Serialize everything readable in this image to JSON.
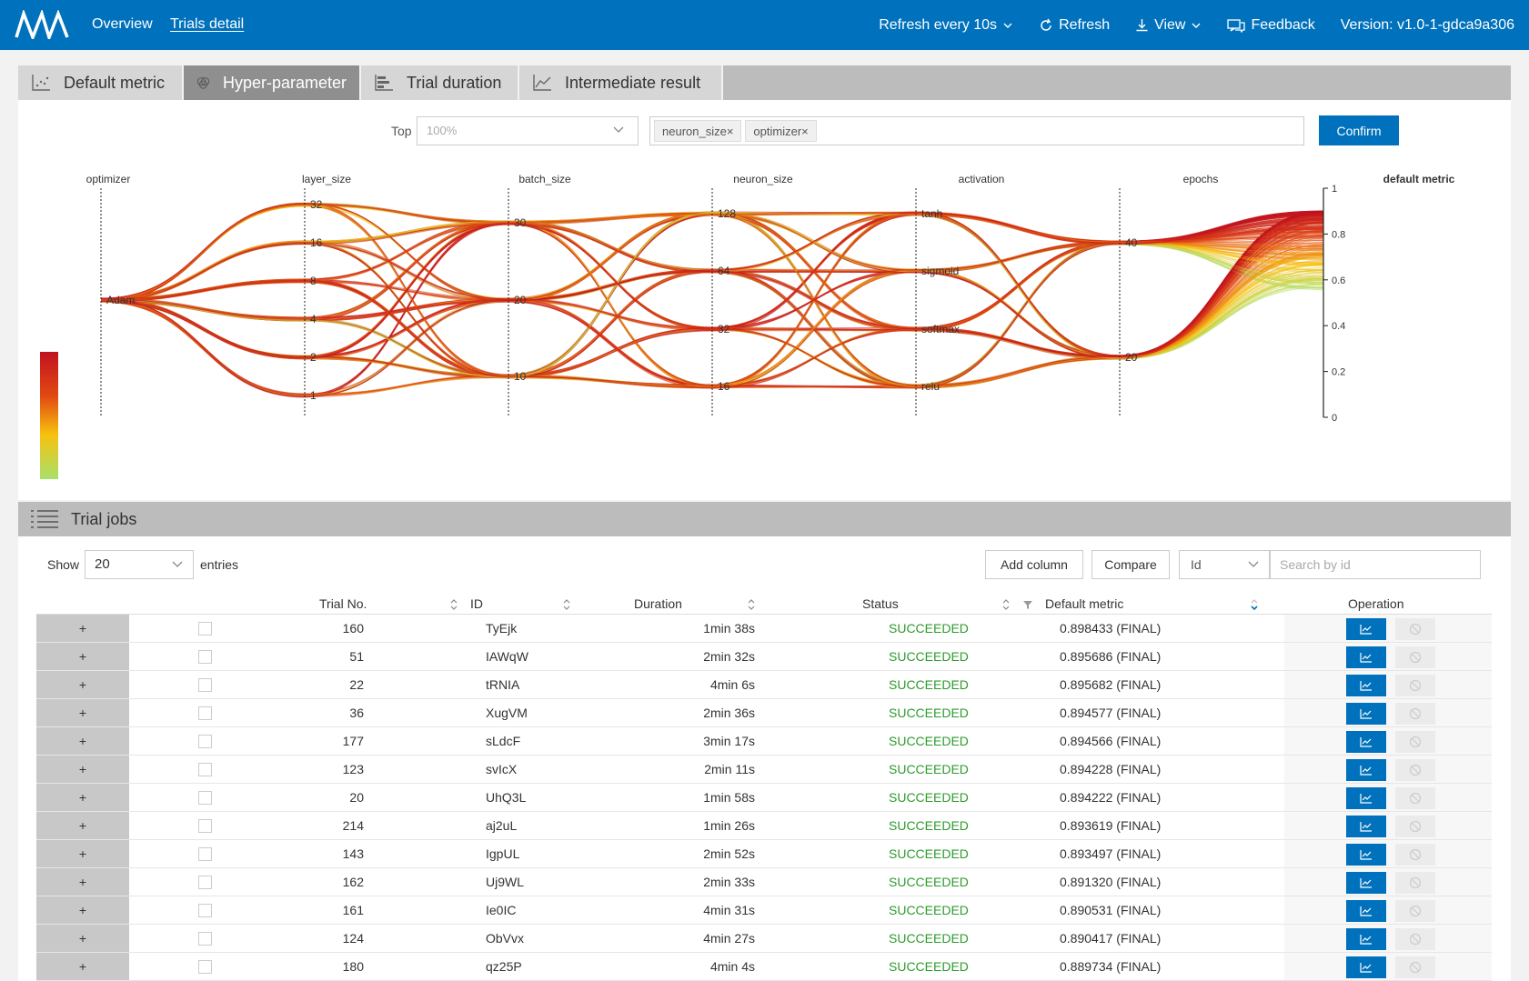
{
  "nav": {
    "overview": "Overview",
    "trials_detail": "Trials detail",
    "refresh_interval": "Refresh every 10s",
    "refresh": "Refresh",
    "view": "View",
    "feedback": "Feedback",
    "version": "Version: v1.0-1-gdca9a306"
  },
  "tabs": [
    "Default metric",
    "Hyper-parameter",
    "Trial duration",
    "Intermediate result"
  ],
  "hyper": {
    "top_label": "Top",
    "top_value": "100%",
    "tags": [
      "neuron_size×",
      "optimizer×"
    ],
    "confirm": "Confirm"
  },
  "chart_data": {
    "type": "parallel-coordinates",
    "axes": [
      {
        "name": "optimizer",
        "ticks": [
          "Adam"
        ]
      },
      {
        "name": "layer_size",
        "ticks": [
          "32",
          "16",
          "8",
          "4",
          "2",
          "1"
        ]
      },
      {
        "name": "batch_size",
        "ticks": [
          "30",
          "20",
          "10"
        ]
      },
      {
        "name": "neuron_size",
        "ticks": [
          "128",
          "64",
          "32",
          "16"
        ]
      },
      {
        "name": "activation",
        "ticks": [
          "tanh",
          "sigmoid",
          "softmax",
          "relu"
        ]
      },
      {
        "name": "epochs",
        "ticks": [
          "40",
          "20"
        ]
      },
      {
        "name": "default metric",
        "ticks": [
          "1",
          "0.8",
          "0.6",
          "0.4",
          "0.2",
          "0"
        ],
        "range": [
          0,
          1
        ]
      }
    ],
    "color_scale": [
      "#c1121f",
      "#e24a12",
      "#f7c10f",
      "#a8e06a"
    ]
  },
  "jobs": {
    "title": "Trial jobs",
    "show": "Show",
    "page_size": "20",
    "entries": "entries",
    "add_column": "Add column",
    "compare": "Compare",
    "search_by": "Id",
    "search_placeholder": "Search by id",
    "columns": [
      "Trial No.",
      "ID",
      "Duration",
      "Status",
      "Default metric",
      "Operation"
    ],
    "expand_symbol": "+",
    "rows": [
      {
        "no": "160",
        "id": "TyEjk",
        "duration": "1min 38s",
        "status": "SUCCEEDED",
        "metric": "0.898433 (FINAL)"
      },
      {
        "no": "51",
        "id": "IAWqW",
        "duration": "2min 32s",
        "status": "SUCCEEDED",
        "metric": "0.895686 (FINAL)"
      },
      {
        "no": "22",
        "id": "tRNIA",
        "duration": "4min 6s",
        "status": "SUCCEEDED",
        "metric": "0.895682 (FINAL)"
      },
      {
        "no": "36",
        "id": "XugVM",
        "duration": "2min 36s",
        "status": "SUCCEEDED",
        "metric": "0.894577 (FINAL)"
      },
      {
        "no": "177",
        "id": "sLdcF",
        "duration": "3min 17s",
        "status": "SUCCEEDED",
        "metric": "0.894566 (FINAL)"
      },
      {
        "no": "123",
        "id": "svIcX",
        "duration": "2min 11s",
        "status": "SUCCEEDED",
        "metric": "0.894228 (FINAL)"
      },
      {
        "no": "20",
        "id": "UhQ3L",
        "duration": "1min 58s",
        "status": "SUCCEEDED",
        "metric": "0.894222 (FINAL)"
      },
      {
        "no": "214",
        "id": "aj2uL",
        "duration": "1min 26s",
        "status": "SUCCEEDED",
        "metric": "0.893619 (FINAL)"
      },
      {
        "no": "143",
        "id": "IgpUL",
        "duration": "2min 52s",
        "status": "SUCCEEDED",
        "metric": "0.893497 (FINAL)"
      },
      {
        "no": "162",
        "id": "Uj9WL",
        "duration": "2min 33s",
        "status": "SUCCEEDED",
        "metric": "0.891320 (FINAL)"
      },
      {
        "no": "161",
        "id": "Ie0IC",
        "duration": "4min 31s",
        "status": "SUCCEEDED",
        "metric": "0.890531 (FINAL)"
      },
      {
        "no": "124",
        "id": "ObVvx",
        "duration": "4min 27s",
        "status": "SUCCEEDED",
        "metric": "0.890417 (FINAL)"
      },
      {
        "no": "180",
        "id": "qz25P",
        "duration": "4min 4s",
        "status": "SUCCEEDED",
        "metric": "0.889734 (FINAL)"
      }
    ]
  }
}
